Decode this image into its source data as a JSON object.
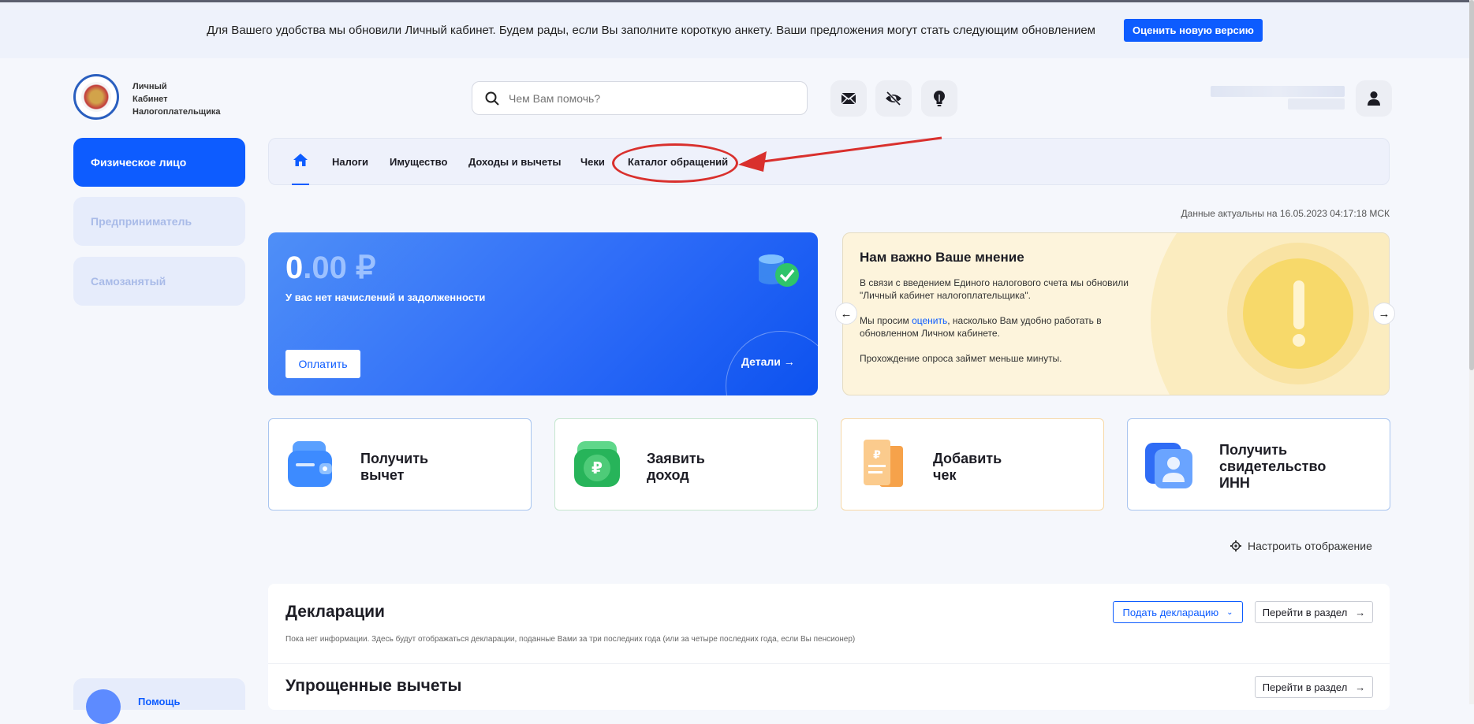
{
  "banner": {
    "text": "Для Вашего удобства мы обновили Личный кабинет. Будем рады, если Вы заполните короткую анкету. Ваши предложения могут стать следующим обновлением",
    "button": "Оценить новую версию"
  },
  "header": {
    "logo_line1": "Личный",
    "logo_line2": "Кабинет",
    "logo_line3": "Налогоплательщика",
    "search_placeholder": "Чем Вам помочь?",
    "icons": [
      "mail-icon",
      "eye-off-icon",
      "lightbulb-icon",
      "user-icon"
    ]
  },
  "sidebar": {
    "items": [
      {
        "label": "Физическое лицо",
        "active": true
      },
      {
        "label": "Предприниматель",
        "active": false
      },
      {
        "label": "Самозанятый",
        "active": false
      }
    ],
    "help": "Помощь"
  },
  "nav": {
    "tabs": [
      {
        "label": "Налоги"
      },
      {
        "label": "Имущество"
      },
      {
        "label": "Доходы и вычеты"
      },
      {
        "label": "Чеки"
      },
      {
        "label": "Каталог обращений"
      }
    ]
  },
  "annotation": {
    "color": "#d9302d"
  },
  "data_actual": "Данные актуальны на 16.05.2023 04:17:18 МСК",
  "balance": {
    "integer": "0",
    "decimal": ".00 ₽",
    "message": "У вас нет начислений и задолженности",
    "pay_button": "Оплатить",
    "details": "Детали"
  },
  "opinion": {
    "title": "Нам важно Ваше мнение",
    "p1": "В связи с введением Единого налогового счета мы обновили \"Личный кабинет налогоплательщика\".",
    "p2_before": "Мы просим ",
    "p2_link": "оценить",
    "p2_after": ", насколько Вам удобно работать в обновленном Личном кабинете.",
    "p3": "Прохождение опроса займет меньше минуты."
  },
  "actions": [
    {
      "line1": "Получить",
      "line2": "вычет",
      "line3": "",
      "color": "#3d8bff"
    },
    {
      "line1": "Заявить",
      "line2": "доход",
      "line3": "",
      "color": "#27b45a"
    },
    {
      "line1": "Добавить",
      "line2": "чек",
      "line3": "",
      "color": "#f6a24a"
    },
    {
      "line1": "Получить",
      "line2": "свидетельство",
      "line3": "ИНН",
      "color": "#2f6cf5"
    }
  ],
  "settings_label": "Настроить отображение",
  "declarations": {
    "title": "Декларации",
    "note": "Пока нет информации. Здесь будут отображаться декларации, поданные Вами за три последних года (или за четыре последних года, если Вы пенсионер)",
    "submit": "Подать декларацию",
    "go": "Перейти в раздел"
  },
  "simplified": {
    "title": "Упрощенные вычеты",
    "go": "Перейти в раздел"
  },
  "colors": {
    "accent": "#0d5cff",
    "annotation": "#d9302d"
  }
}
